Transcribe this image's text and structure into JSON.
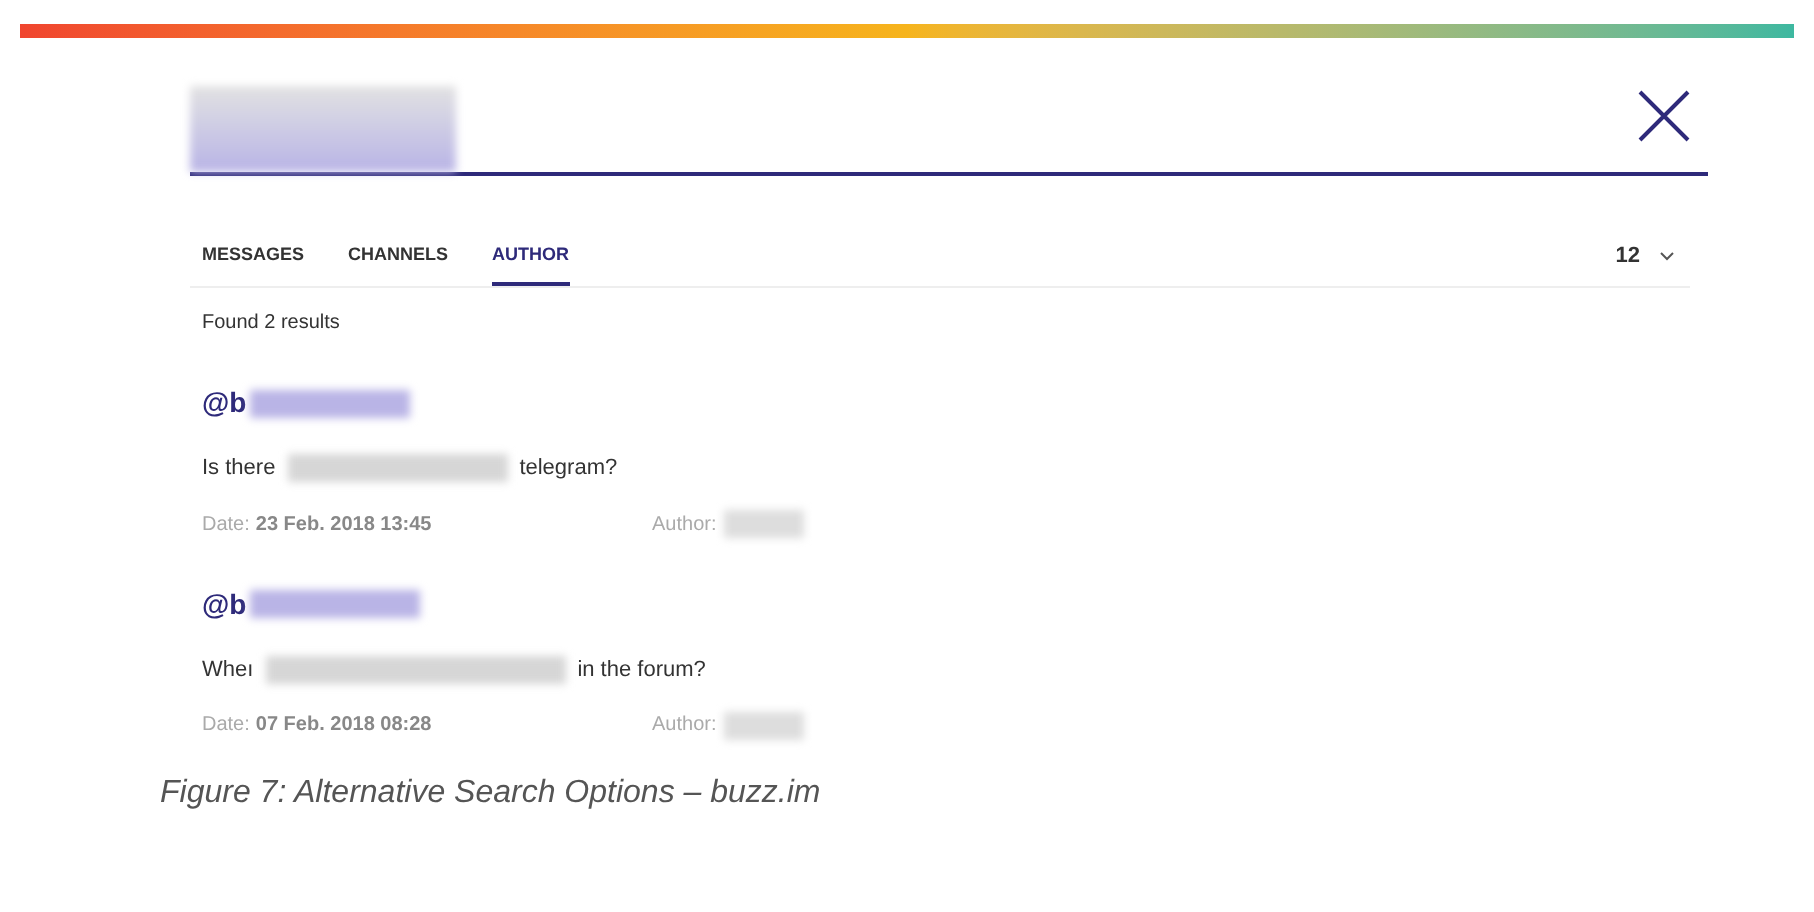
{
  "tabs": [
    {
      "label": "MESSAGES",
      "selected": false
    },
    {
      "label": "CHANNELS",
      "selected": false
    },
    {
      "label": "AUTHOR",
      "selected": true
    }
  ],
  "page_size": {
    "value": "12"
  },
  "results_count": "Found 2 results",
  "results": [
    {
      "username": "@b",
      "question_start": "Is there",
      "question_end": "telegram?",
      "date_label": "Date:",
      "date": "23 Feb. 2018 13:45",
      "author_label": "Author:"
    },
    {
      "username": "@b",
      "question_start": "Wheı",
      "question_end": "in the forum?",
      "date_label": "Date:",
      "date": "07 Feb. 2018 08:28",
      "author_label": "Author:"
    }
  ],
  "caption": "Figure 7: Alternative Search Options – buzz.im"
}
